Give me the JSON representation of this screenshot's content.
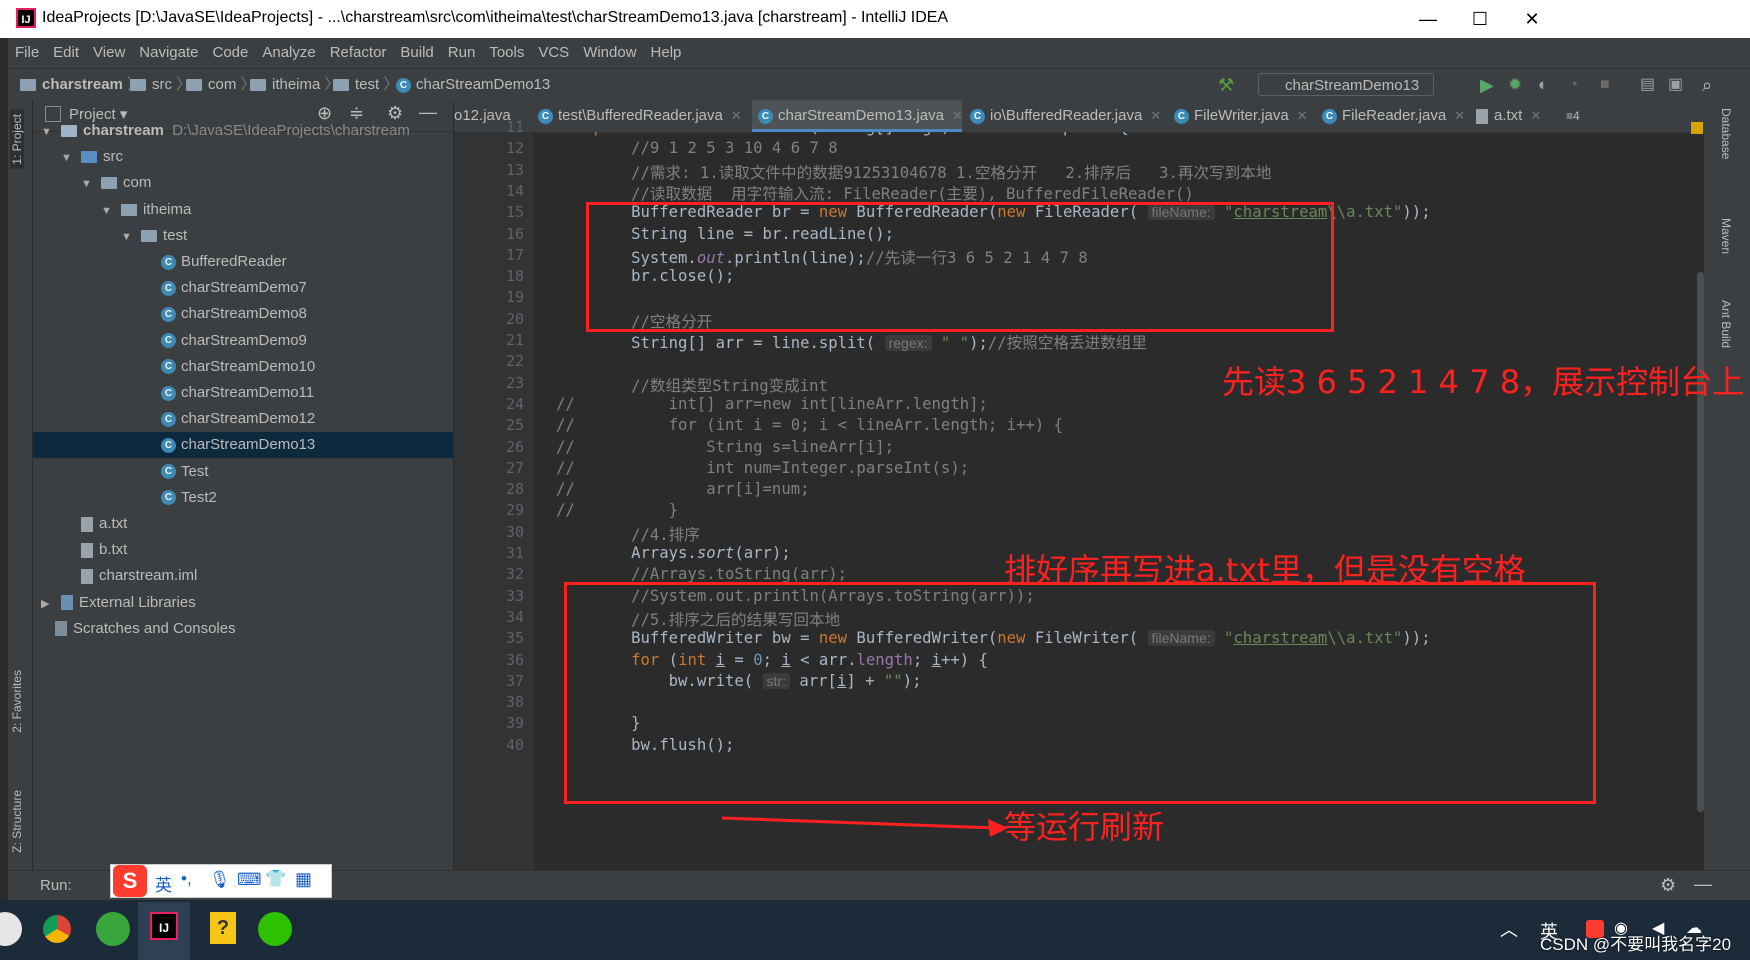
{
  "window": {
    "title": "IdeaProjects [D:\\JavaSE\\IdeaProjects] - ...\\charstream\\src\\com\\itheima\\test\\charStreamDemo13.java [charstream] - IntelliJ IDEA",
    "minimize": "—",
    "maximize": "☐",
    "close": "✕"
  },
  "menu": [
    "File",
    "Edit",
    "View",
    "Navigate",
    "Code",
    "Analyze",
    "Refactor",
    "Build",
    "Run",
    "Tools",
    "VCS",
    "Window",
    "Help"
  ],
  "breadcrumb": [
    "charstream",
    "src",
    "com",
    "itheima",
    "test",
    "charStreamDemo13"
  ],
  "run_config": "charStreamDemo13",
  "project_panel": {
    "title": "Project",
    "tree": [
      {
        "label": "charstream",
        "path": "D:\\JavaSE\\IdeaProjects\\charstream",
        "depth": 0,
        "type": "module",
        "expanded": true
      },
      {
        "label": "src",
        "depth": 1,
        "type": "folder",
        "expanded": true
      },
      {
        "label": "com",
        "depth": 2,
        "type": "folder",
        "expanded": true
      },
      {
        "label": "itheima",
        "depth": 3,
        "type": "folder",
        "expanded": true
      },
      {
        "label": "test",
        "depth": 4,
        "type": "folder",
        "expanded": true
      },
      {
        "label": "BufferedReader",
        "depth": 5,
        "type": "class"
      },
      {
        "label": "charStreamDemo7",
        "depth": 5,
        "type": "class"
      },
      {
        "label": "charStreamDemo8",
        "depth": 5,
        "type": "class"
      },
      {
        "label": "charStreamDemo9",
        "depth": 5,
        "type": "class"
      },
      {
        "label": "charStreamDemo10",
        "depth": 5,
        "type": "class"
      },
      {
        "label": "charStreamDemo11",
        "depth": 5,
        "type": "class"
      },
      {
        "label": "charStreamDemo12",
        "depth": 5,
        "type": "class"
      },
      {
        "label": "charStreamDemo13",
        "depth": 5,
        "type": "class",
        "selected": true
      },
      {
        "label": "Test",
        "depth": 5,
        "type": "class"
      },
      {
        "label": "Test2",
        "depth": 5,
        "type": "class"
      },
      {
        "label": "a.txt",
        "depth": 1,
        "type": "file"
      },
      {
        "label": "b.txt",
        "depth": 1,
        "type": "file"
      },
      {
        "label": "charstream.iml",
        "depth": 1,
        "type": "file"
      },
      {
        "label": "External Libraries",
        "depth": 0,
        "type": "lib",
        "expanded": false
      },
      {
        "label": "Scratches and Consoles",
        "depth": 0,
        "type": "scratch"
      }
    ]
  },
  "left_stripe": {
    "project": "1: Project",
    "favorites": "2: Favorites",
    "structure": "Z: Structure"
  },
  "right_stripe": {
    "database": "Database",
    "maven": "Maven",
    "ant": "Ant Build"
  },
  "tabs": [
    {
      "label": "o12.java"
    },
    {
      "label": "test\\BufferedReader.java"
    },
    {
      "label": "charStreamDemo13.java",
      "active": true
    },
    {
      "label": "io\\BufferedReader.java"
    },
    {
      "label": "FileWriter.java"
    },
    {
      "label": "FileReader.java"
    },
    {
      "label": "a.txt"
    }
  ],
  "tabs_overflow": "≡4",
  "code_lines": [
    {
      "n": "11",
      "html": "    <span class='kw'>public static void</span> main(String[] args) <span class='kw'>throws</span> Exception {"
    },
    {
      "n": "12",
      "html": "        <span class='cm'>//9 1 2 5 3 10 4 6 7 8</span>"
    },
    {
      "n": "13",
      "html": "        <span class='cm'>//需求: 1.读取文件中的数据91253104678 1.空格分开   2.排序后   3.再次写到本地</span>"
    },
    {
      "n": "14",
      "html": "        <span class='cm'>//读取数据  用字符输入流: FileReader(主要), BufferedFileReader()</span>"
    },
    {
      "n": "15",
      "html": "        BufferedReader br = <span class='kw'>new</span> BufferedReader(<span class='kw'>new</span> FileReader( <span class='hint'>fileName:</span> <span class='str'>\"<span class='und'>charstream</span>\\\\a.txt\"</span>));"
    },
    {
      "n": "16",
      "html": "        String line = br.readLine();"
    },
    {
      "n": "17",
      "html": "        System.<span class='fld'>out</span>.println(line);<span class='cm'>//先读一行3 6 5 2 1 4 7 8</span>"
    },
    {
      "n": "18",
      "html": "        br.close();"
    },
    {
      "n": "19",
      "html": ""
    },
    {
      "n": "20",
      "html": "        <span class='cm'>//空格分开</span>"
    },
    {
      "n": "21",
      "html": "        String[] arr = line.split( <span class='hint'>regex:</span> <span class='str'>\" \"</span>);<span class='cm'>//按照空格丢进数组里</span>"
    },
    {
      "n": "22",
      "html": ""
    },
    {
      "n": "23",
      "html": "        <span class='cm'>//数组类型String变成int</span>"
    },
    {
      "n": "24",
      "html": "<span class='cm'>//</span>          <span class='cm'>int[] arr=new int[lineArr.length];</span>"
    },
    {
      "n": "25",
      "html": "<span class='cm'>//</span>          <span class='cm'>for (int i = 0; i &lt; lineArr.length; i++) {</span>"
    },
    {
      "n": "26",
      "html": "<span class='cm'>//</span>              <span class='cm'>String s=lineArr[i];</span>"
    },
    {
      "n": "27",
      "html": "<span class='cm'>//</span>              <span class='cm'>int num=Integer.parseInt(s);</span>"
    },
    {
      "n": "28",
      "html": "<span class='cm'>//</span>              <span class='cm'>arr[i]=num;</span>"
    },
    {
      "n": "29",
      "html": "<span class='cm'>//</span>          <span class='cm'>}</span>"
    },
    {
      "n": "30",
      "html": "        <span class='cm'>//4.排序</span>"
    },
    {
      "n": "31",
      "html": "        Arrays.<span class='it'>sort</span>(arr);"
    },
    {
      "n": "32",
      "html": "        <span class='cm'>//Arrays.toString(arr);</span>"
    },
    {
      "n": "33",
      "html": "        <span class='cm'>//System.out.println(Arrays.toString(arr));</span>"
    },
    {
      "n": "34",
      "html": "        <span class='cm'>//5.排序之后的结果写回本地</span>"
    },
    {
      "n": "35",
      "html": "        BufferedWriter bw = <span class='kw'>new</span> BufferedWriter(<span class='kw'>new</span> FileWriter( <span class='hint'>fileName:</span> <span class='str'>\"<span class='und'>charstream</span>\\\\a.txt\"</span>));"
    },
    {
      "n": "36",
      "html": "        <span class='kw'>for</span> (<span class='kw'>int</span> <span class='und'>i</span> = <span class='str' style='color:#6897bb'>0</span>; <span class='und'>i</span> &lt; arr.<span class='fld' style='font-style:normal'>length</span>; <span class='und'>i</span>++) {"
    },
    {
      "n": "37",
      "html": "            bw.write( <span class='hint'>str:</span> arr[<span class='und'>i</span>] + <span class='str'>\"\"</span>);"
    },
    {
      "n": "38",
      "html": ""
    },
    {
      "n": "39",
      "html": "        }"
    },
    {
      "n": "40",
      "html": "        bw.flush();"
    }
  ],
  "annotations": {
    "a1": "先读3 6 5 2 1 4 7 8，展示控制台上",
    "a2": "排好序再写进a.txt里，但是没有空格",
    "a3": "等运行刷新"
  },
  "run_bar": {
    "label": "Run:"
  },
  "ime": {
    "lang": "英",
    "punct": "•,"
  },
  "taskbar": {
    "tray_lang": "英",
    "watermark": "CSDN @不要叫我名字20"
  }
}
